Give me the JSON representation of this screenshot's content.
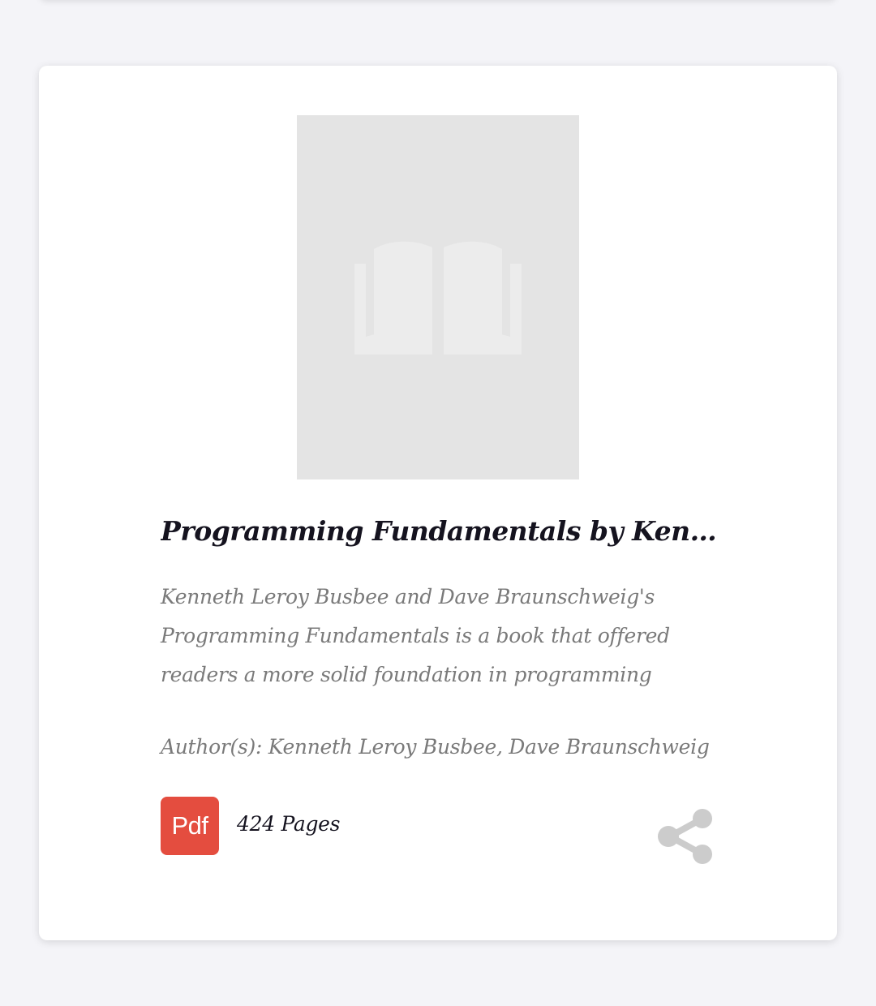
{
  "book": {
    "title": "Programming Fundamentals by Kenneth...",
    "description": "Kenneth Leroy Busbee and Dave Braunschweig's Programming Fundamentals is a book that offered readers a more solid foundation in programming",
    "authors_label": "Author(s):",
    "authors": "Kenneth Leroy Busbee, Dave Braunschweig",
    "format_badge": "Pdf",
    "pages": "424 Pages"
  },
  "icons": {
    "cover_placeholder": "open-book-icon",
    "share": "share-icon"
  },
  "colors": {
    "background": "#f4f4f8",
    "card": "#ffffff",
    "cover_placeholder": "#e4e4e4",
    "pdf_badge": "#e44d3f",
    "title_text": "#15131f",
    "muted_text": "#7a7a7a",
    "share_icon": "#cccccc"
  }
}
